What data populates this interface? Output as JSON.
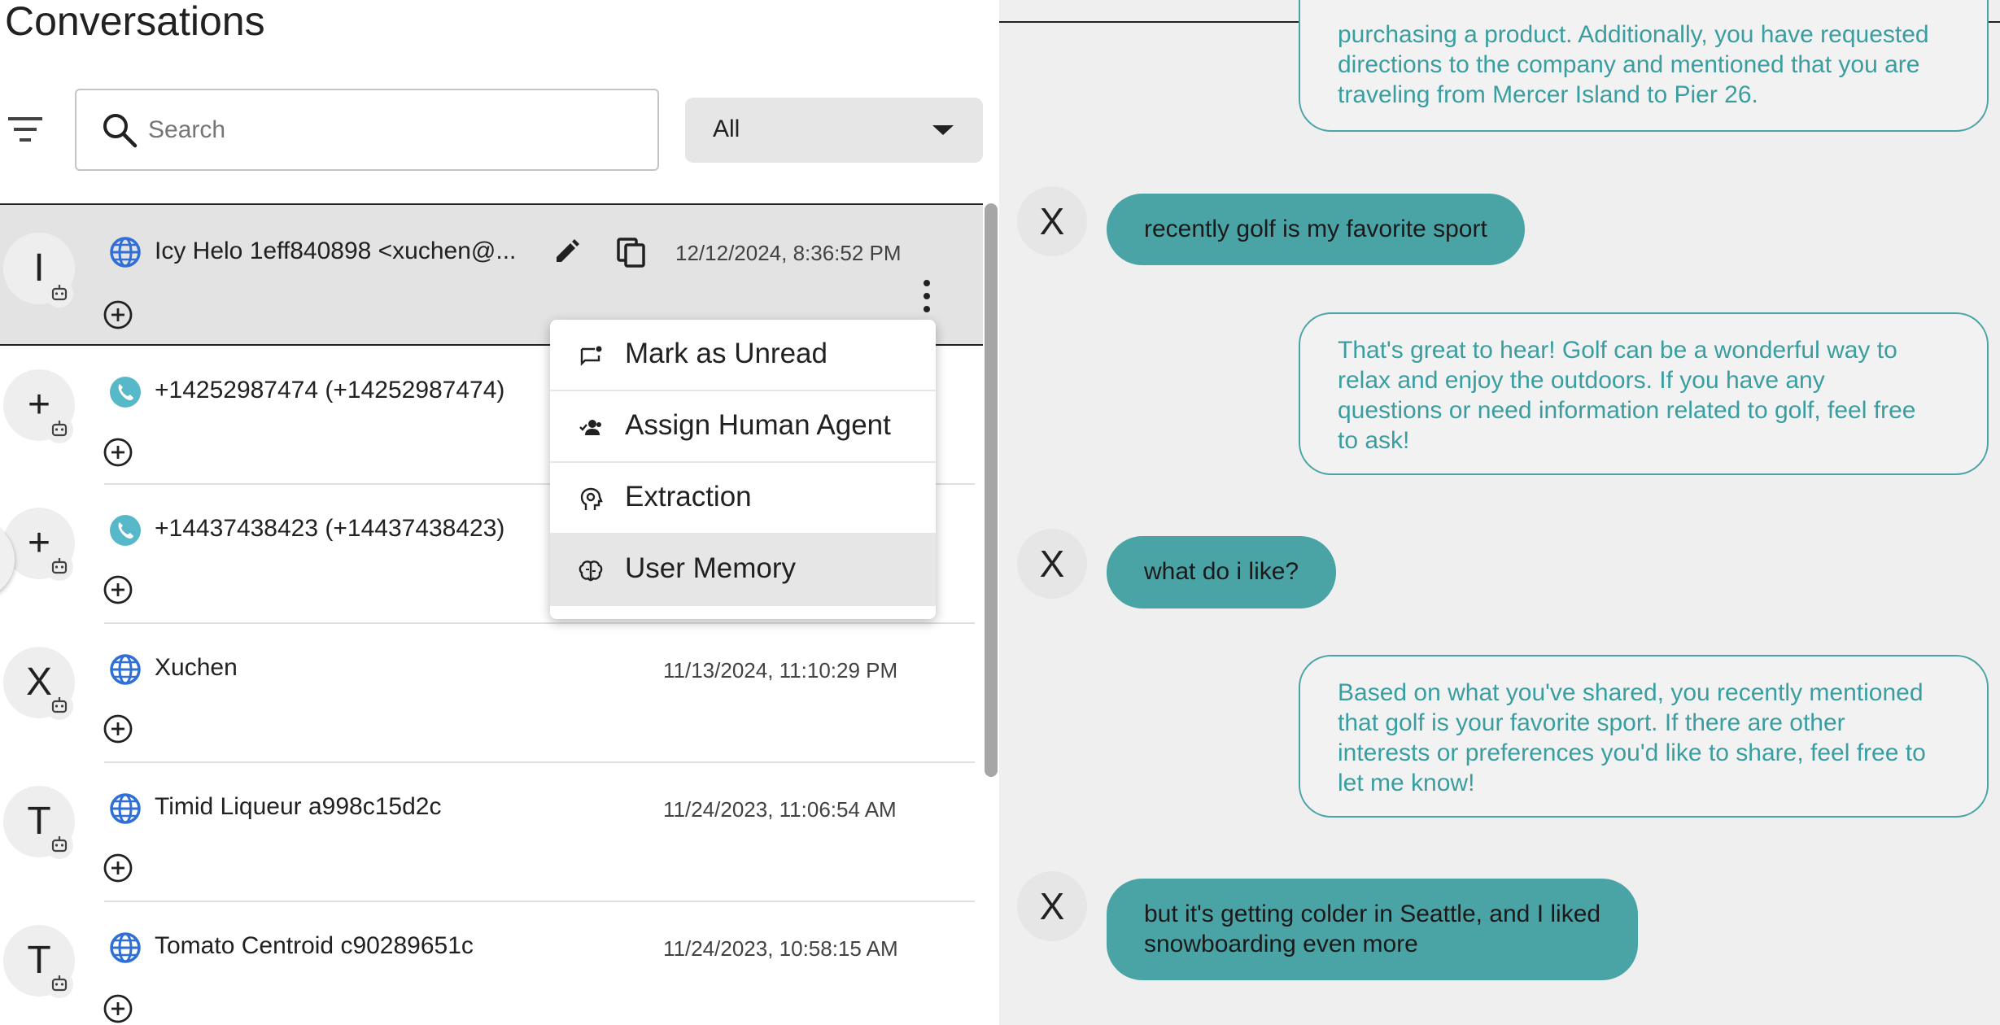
{
  "header": {
    "title": "Conversations"
  },
  "search": {
    "placeholder": "Search"
  },
  "filter_select": {
    "value": "All"
  },
  "conversations": [
    {
      "avatar": "I",
      "channel": "web",
      "name": "Icy Helo 1eff840898 <xuchen@...",
      "time": "12/12/2024, 8:36:52 PM",
      "selected": true
    },
    {
      "avatar": "+",
      "channel": "phone",
      "name": "+14252987474 (+14252987474)",
      "time": ""
    },
    {
      "avatar": "+",
      "channel": "phone",
      "name": "+14437438423 (+14437438423)",
      "time": ""
    },
    {
      "avatar": "X",
      "channel": "web",
      "name": "Xuchen",
      "time": "11/13/2024, 11:10:29 PM"
    },
    {
      "avatar": "T",
      "channel": "web",
      "name": "Timid Liqueur a998c15d2c",
      "time": "11/24/2023, 11:06:54 AM"
    },
    {
      "avatar": "T",
      "channel": "web",
      "name": "Tomato Centroid c90289651c",
      "time": "11/24/2023, 10:58:15 AM"
    }
  ],
  "context_menu": {
    "items": [
      {
        "label": "Mark as Unread",
        "icon": "mark-unread-icon"
      },
      {
        "label": "Assign Human Agent",
        "icon": "assign-agent-icon"
      },
      {
        "label": "Extraction",
        "icon": "extraction-icon"
      },
      {
        "label": "User Memory",
        "icon": "brain-icon"
      }
    ],
    "highlighted": "User Memory"
  },
  "chat": {
    "messages": [
      {
        "role": "bot",
        "lines": [
          "purchasing a product. Additionally, you have requested",
          "directions to the company and mentioned that you are",
          "traveling from Mercer Island to Pier 26."
        ]
      },
      {
        "role": "user",
        "avatar": "X",
        "lines": [
          "recently golf is my favorite sport"
        ]
      },
      {
        "role": "bot",
        "lines": [
          "That's great to hear! Golf can be a wonderful way to",
          "relax and enjoy the outdoors. If you have any",
          "questions or need information related to golf, feel free",
          "to ask!"
        ]
      },
      {
        "role": "user",
        "avatar": "X",
        "lines": [
          "what do i like?"
        ]
      },
      {
        "role": "bot",
        "lines": [
          "Based on what you've shared, you recently mentioned",
          "that golf is your favorite sport. If there are other",
          "interests or preferences you'd like to share, feel free to",
          "let me know!"
        ]
      },
      {
        "role": "user",
        "avatar": "X",
        "lines": [
          "but it's getting colder in Seattle, and I liked",
          "snowboarding even more"
        ]
      }
    ]
  },
  "colors": {
    "accent_teal": "#4aa3a5",
    "bot_text": "#3a9ea0",
    "channel_web": "#2f6fd6",
    "channel_phone": "#56b8c9",
    "selected_row": "#e3e3e3"
  }
}
